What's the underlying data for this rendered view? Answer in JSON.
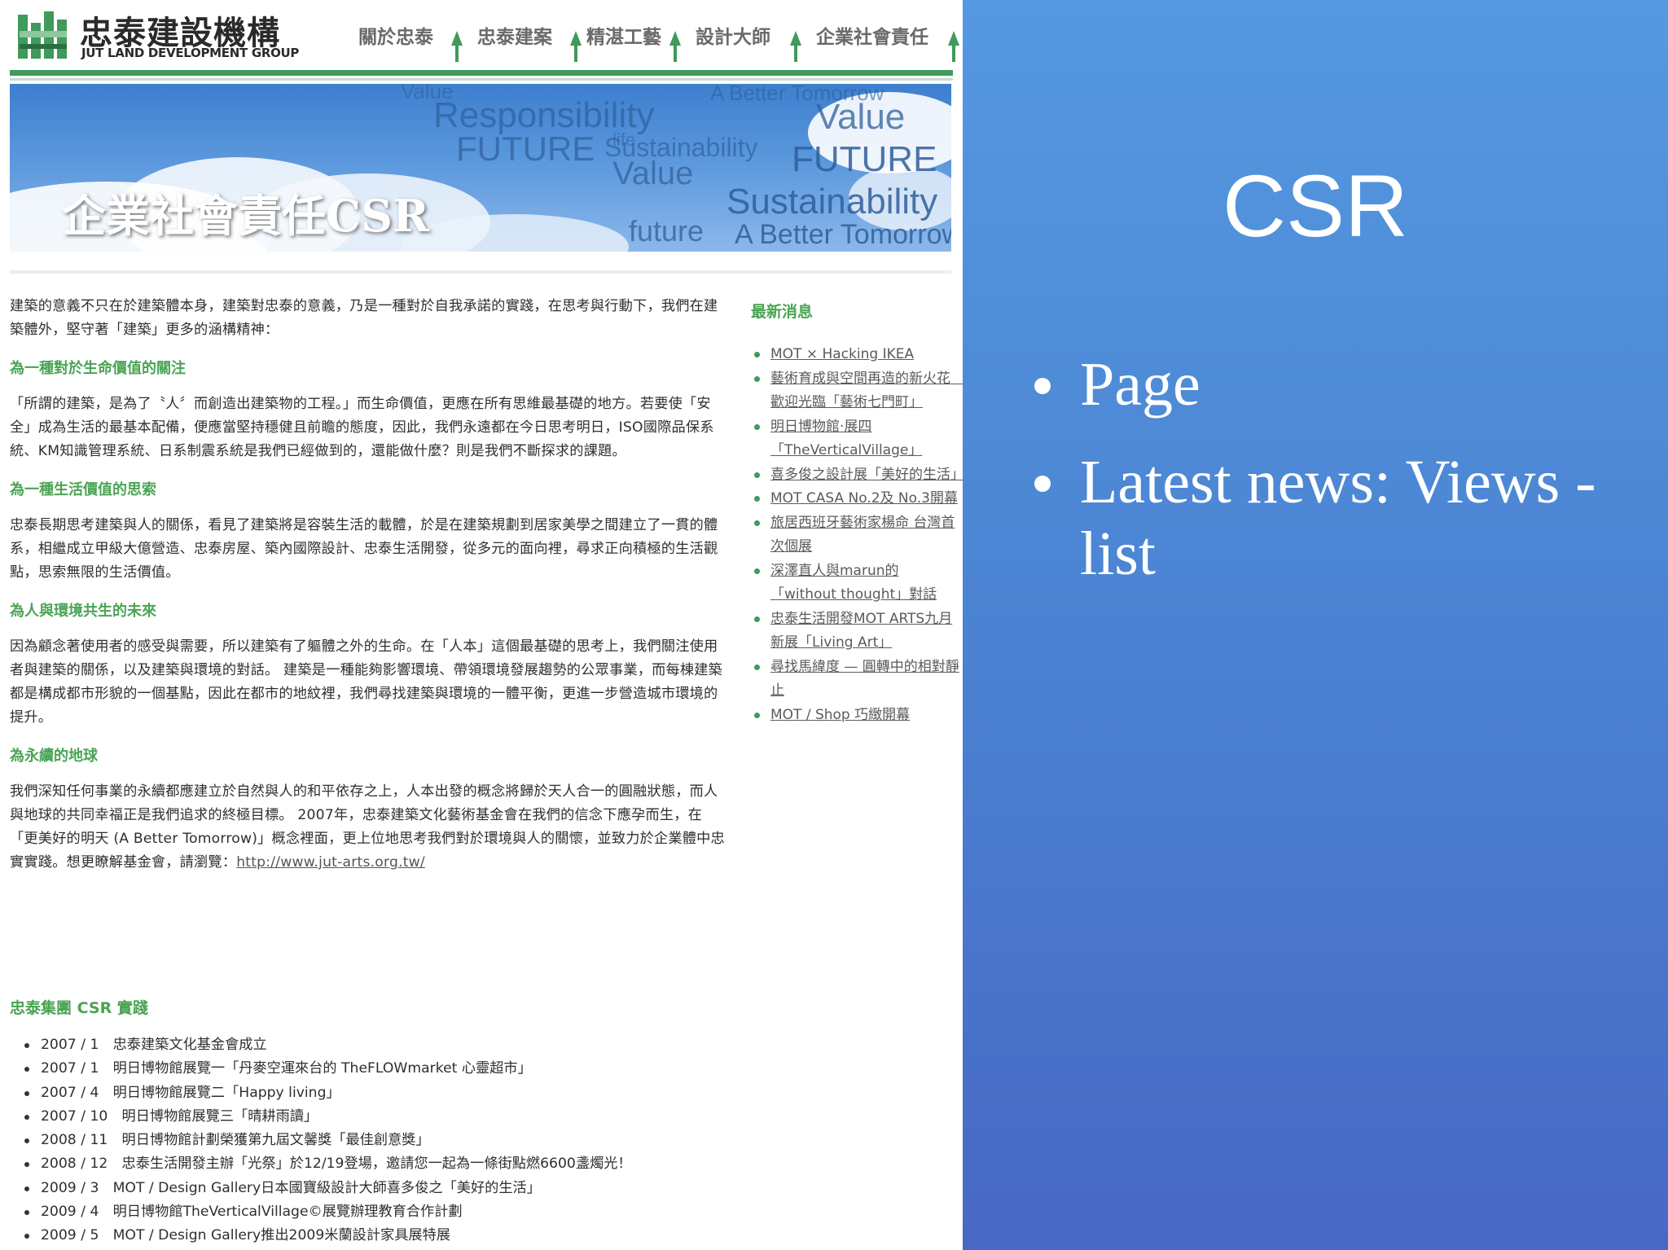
{
  "site": {
    "logo": {
      "cn": "忠泰建設機構",
      "en": "JUT LAND DEVELOPMENT GROUP"
    },
    "nav": [
      {
        "label": "關於忠泰"
      },
      {
        "label": "忠泰建案"
      },
      {
        "label": "精湛工藝"
      },
      {
        "label": "設計大師"
      },
      {
        "label": "企業社會責任"
      }
    ],
    "banner": {
      "title": "企業社會責任CSR",
      "words": [
        "Value",
        "A Better Tomorrow",
        "Responsibility",
        "FUTURE",
        "Sustainability",
        "future",
        "life"
      ]
    },
    "article": {
      "intro": "建築的意義不只在於建築體本身，建築對忠泰的意義，乃是一種對於自我承諾的實踐，在思考與行動下，我們在建築體外，堅守著「建築」更多的涵構精神：",
      "sections": [
        {
          "heading": "為一種對於生命價值的關注",
          "body": "「所謂的建築，是為了〝人〞而創造出建築物的工程。」而生命價值，更應在所有思維最基礎的地方。若要使「安全」成為生活的最基本配備，便應當堅持穩健且前瞻的態度，因此，我們永遠都在今日思考明日，ISO國際品保系統、KM知識管理系統、日系制震系統是我們已經做到的，還能做什麼？則是我們不斷探求的課題。"
        },
        {
          "heading": "為一種生活價值的思索",
          "body": "忠泰長期思考建築與人的關係，看見了建築將是容裝生活的載體，於是在建築規劃到居家美學之間建立了一貫的體系，相繼成立甲級大億營造、忠泰房屋、築內國際設計、忠泰生活開發，從多元的面向裡，尋求正向積極的生活觀點，思索無限的生活價值。"
        },
        {
          "heading": "為人與環境共生的未來",
          "body": "因為顧念著使用者的感受與需要，所以建築有了軀體之外的生命。在「人本」這個最基礎的思考上，我們關注使用者與建築的關係，以及建築與環境的對話。 建築是一種能夠影響環境、帶領環境發展趨勢的公眾事業，而每棟建築都是構成都市形貌的一個基點，因此在都市的地紋裡，我們尋找建築與環境的一體平衡，更進一步營造城市環境的提升。"
        },
        {
          "heading": "為永續的地球",
          "body": "我們深知任何事業的永續都應建立於自然與人的和平依存之上，人本出發的概念將歸於天人合一的圓融狀態，而人與地球的共同幸福正是我們追求的終極目標。 2007年，忠泰建築文化藝術基金會在我們的信念下應孕而生，在「更美好的明天 (A Better Tomorrow)」概念裡面，更上位地思考我們對於環境與人的關懷，並致力於企業體中忠實實踐。想更瞭解基金會，請瀏覽："
        }
      ],
      "foundation_link": "http://www.jut-arts.org.tw/"
    },
    "news": {
      "title": "最新消息",
      "items": [
        "MOT × Hacking IKEA",
        "藝術育成與空間再造的新火花　歡迎光臨「藝術七門町」",
        "明日博物館‧展四「TheVerticalVillage」",
        "喜多俊之設計展「美好的生活」",
        "MOT CASA No.2及 No.3開幕",
        "旅居西班牙藝術家楊命 台灣首次個展",
        "深澤直人與marun的「without thought」對話",
        "忠泰生活開發MOT ARTS九月新展「Living Art」",
        "尋找馬緯度 — 圓轉中的相對靜止",
        "MOT / Shop 巧緻開幕"
      ]
    },
    "csr_practice": {
      "title": "忠泰集團 CSR 實踐",
      "items": [
        "2007 / 1　忠泰建築文化基金會成立",
        "2007 / 1　明日博物館展覽一「丹麥空運來台的 TheFLOWmarket 心靈超市」",
        "2007 / 4　明日博物館展覽二「Happy living」",
        "2007 / 10　明日博物館展覽三「晴耕雨讀」",
        "2008 / 11　明日博物館計劃榮獲第九屆文馨獎「最佳創意獎」",
        "2008 / 12　忠泰生活開發主辦「光祭」於12/19登場，邀請您一起為一條街點燃6600盞燭光！",
        "2009 / 3　MOT / Design Gallery日本國寶級設計大師喜多俊之「美好的生活」",
        "2009 / 4　明日博物館TheVerticalVillage©展覽辦理教育合作計劃",
        "2009 / 5　MOT / Design Gallery推出2009米蘭設計家具展特展"
      ]
    }
  },
  "slide": {
    "title": "CSR",
    "bullets": [
      "Page",
      "Latest news: Views - list"
    ]
  },
  "colors": {
    "brand_green": "#3f9a5b",
    "heading_green": "#4aa453",
    "slide_blue": "#4b83d2"
  }
}
